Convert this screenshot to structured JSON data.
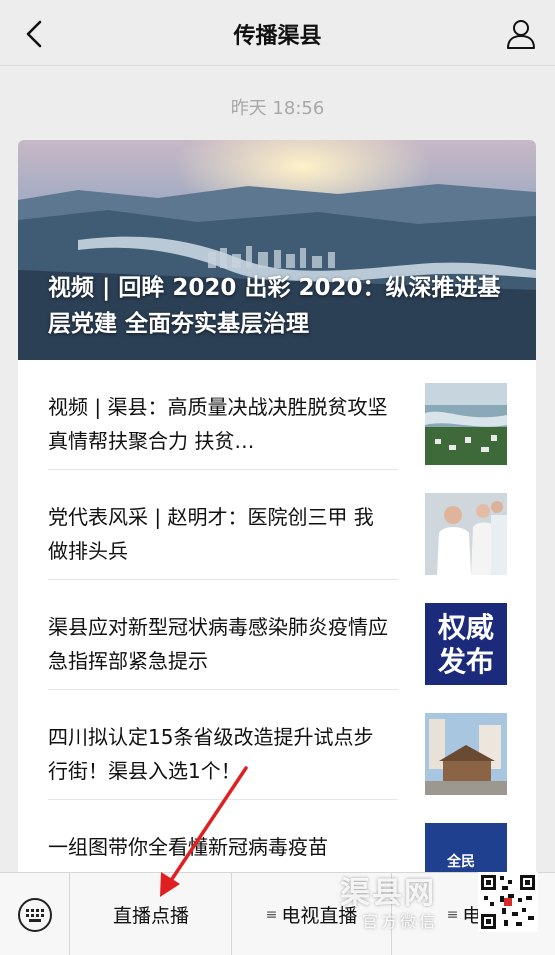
{
  "header": {
    "title": "传播渠县",
    "back_icon": "chevron-left-icon",
    "profile_icon": "user-icon"
  },
  "timestamp": "昨天 18:56",
  "hero": {
    "title": "视频 | 回眸 2020 出彩 2020：纵深推进基层党建 全面夯实基层治理"
  },
  "articles": [
    {
      "title": "视频 | 渠县：高质量决战决胜脱贫攻坚 真情帮扶聚合力 扶贫…",
      "thumb": "aerial-town-thumbnail"
    },
    {
      "title": "党代表风采 | 赵明才：医院创三甲 我做排头兵",
      "thumb": "doctors-thumbnail"
    },
    {
      "title": "渠县应对新型冠状病毒感染肺炎疫情应急指挥部紧急提示",
      "thumb": "authority-release-thumbnail",
      "thumb_text": "权威发布"
    },
    {
      "title": "四川拟认定15条省级改造提升试点步行街！渠县入选1个！",
      "thumb": "pedestrian-street-thumbnail"
    },
    {
      "title": "一组图带你全看懂新冠病毒疫苗",
      "thumb": "vaccine-thumbnail",
      "thumb_text": "全民"
    }
  ],
  "bottom_bar": {
    "keyboard_icon": "keyboard-icon",
    "menus": [
      "直播点播",
      "电视直播",
      "电台"
    ]
  },
  "watermark": {
    "main": "渠县网",
    "sub": "官方微信"
  },
  "colors": {
    "arrow": "#e02020",
    "bg": "#ededed",
    "authority_blue": "#1b2a7a"
  }
}
